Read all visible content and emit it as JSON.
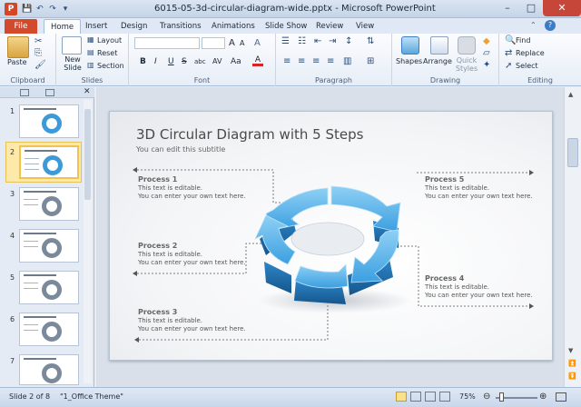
{
  "window": {
    "title": "6015-05-3d-circular-diagram-wide.pptx - Microsoft PowerPoint",
    "app_icon": "P",
    "minimize": "–",
    "maximize": "□",
    "close": "✕"
  },
  "quick_access": {
    "save": "💾",
    "undo": "↶",
    "redo": "↷",
    "customize": "▾"
  },
  "tabs": {
    "file": "File",
    "items": [
      "Home",
      "Insert",
      "Design",
      "Transitions",
      "Animations",
      "Slide Show",
      "Review",
      "View"
    ]
  },
  "ribbon": {
    "clipboard": {
      "label": "Clipboard",
      "paste": "Paste"
    },
    "slides": {
      "label": "Slides",
      "new_slide": "New Slide",
      "layout": "Layout",
      "reset": "Reset",
      "section": "Section"
    },
    "font": {
      "label": "Font",
      "bold": "B",
      "italic": "I",
      "underline": "U",
      "strike": "S",
      "shadow": "abc",
      "spacing": "AV",
      "case": "Aa",
      "grow": "A",
      "shrink": "A",
      "clear": "A"
    },
    "paragraph": {
      "label": "Paragraph"
    },
    "drawing": {
      "label": "Drawing",
      "shapes": "Shapes",
      "arrange": "Arrange",
      "quick_styles": "Quick Styles"
    },
    "editing": {
      "label": "Editing",
      "find": "Find",
      "replace": "Replace",
      "select": "Select"
    }
  },
  "thumbnails": [
    "1",
    "2",
    "3",
    "4",
    "5",
    "6",
    "7"
  ],
  "slide": {
    "title": "3D Circular Diagram with 5 Steps",
    "subtitle": "You can edit this subtitle",
    "processes": [
      {
        "title": "Process 1",
        "line1": "This text is editable.",
        "line2": "You can enter your own text here."
      },
      {
        "title": "Process 2",
        "line1": "This text is editable.",
        "line2": "You can enter your own text here."
      },
      {
        "title": "Process 3",
        "line1": "This text is editable.",
        "line2": "You can enter your own text here."
      },
      {
        "title": "Process 4",
        "line1": "This text is editable.",
        "line2": "You can enter your own text here."
      },
      {
        "title": "Process 5",
        "line1": "This text is editable.",
        "line2": "You can enter your own text here."
      }
    ]
  },
  "status": {
    "slide": "Slide 2 of 8",
    "theme": "\"1_Office Theme\"",
    "zoom": "75%"
  },
  "colors": {
    "accent_file": "#d2492b",
    "diagram_blue": "#3b9fe0",
    "diagram_dark": "#1f6fae"
  }
}
